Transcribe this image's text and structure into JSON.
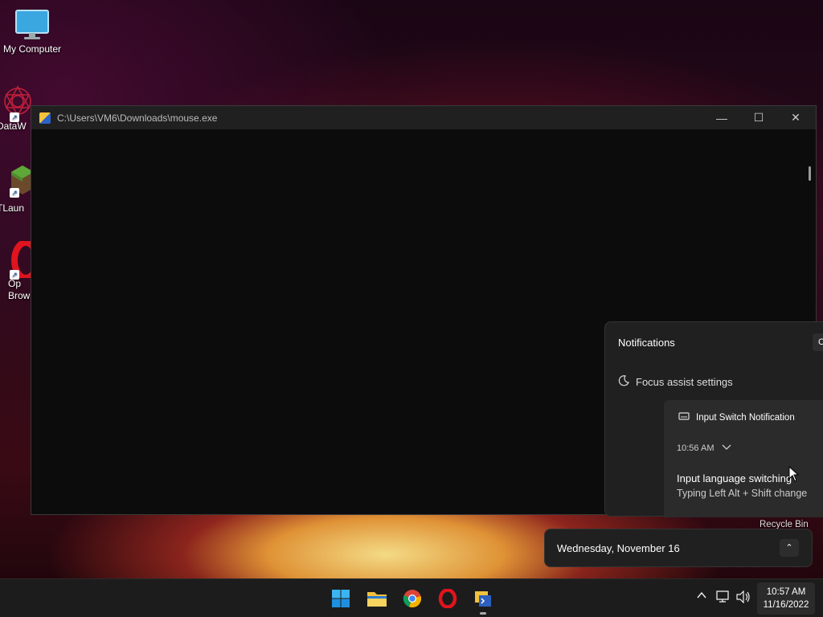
{
  "desktop": {
    "icons": [
      {
        "label": "My Computer"
      },
      {
        "label": "DataW"
      },
      {
        "label": "TLaun"
      },
      {
        "label": "Op\nBrow"
      }
    ],
    "recycle_bin": "Recycle Bin"
  },
  "console": {
    "title": "C:\\Users\\VM6\\Downloads\\mouse.exe",
    "min_glyph": "—",
    "max_glyph": "☐",
    "close_glyph": "✕"
  },
  "notifications": {
    "header": "Notifications",
    "clear_label": "C",
    "focus_assist": "Focus assist settings",
    "card": {
      "app": "Input Switch Notification",
      "time": "10:56 AM",
      "title": "Input language switching",
      "message": "Typing Left Alt + Shift change"
    }
  },
  "calendar": {
    "date": "Wednesday, November 16",
    "expand_glyph": "⌃"
  },
  "taskbar": {
    "apps": [
      "start-icon",
      "file-explorer-icon",
      "chrome-icon",
      "opera-icon",
      "console-app-icon"
    ],
    "tray": {
      "chevron": "^",
      "network": "⊡",
      "volume": "🔊"
    },
    "time": "10:57 AM",
    "date": "11/16/2022"
  }
}
